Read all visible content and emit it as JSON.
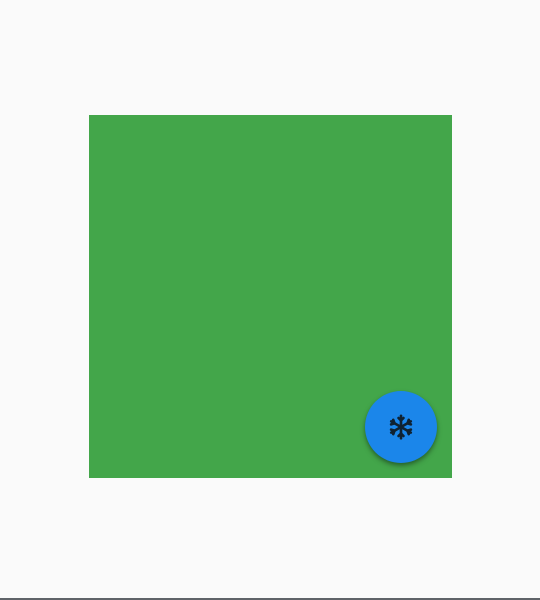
{
  "panel": {
    "color": "#43a64a"
  },
  "fab": {
    "icon": "snowflake-icon",
    "background": "#1b86ea",
    "icon_color": "#0f2232"
  },
  "bottom_rule": {
    "color": "#5f6368"
  }
}
